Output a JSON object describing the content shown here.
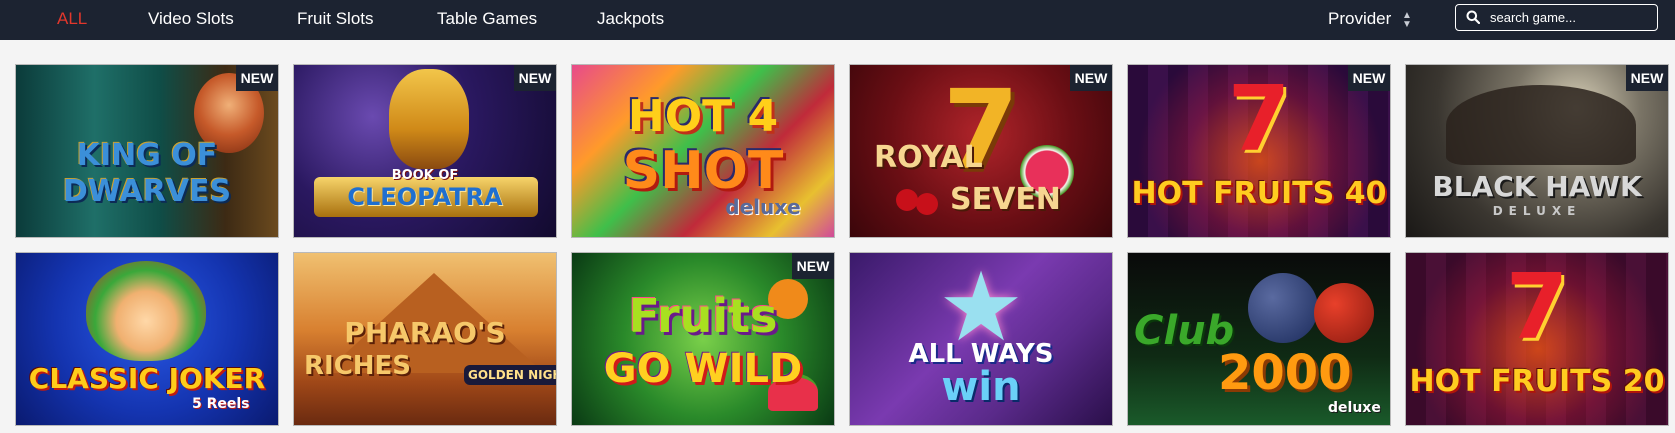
{
  "nav": {
    "items": [
      {
        "label": "ALL",
        "active": true
      },
      {
        "label": "Video Slots"
      },
      {
        "label": "Fruit Slots"
      },
      {
        "label": "Table Games"
      },
      {
        "label": "Jackpots"
      }
    ],
    "provider_label": "Provider",
    "search_placeholder": "search game..."
  },
  "colors": {
    "topbar": "#1c2331",
    "active_nav": "#e2372c",
    "page_bg": "#f4f4f4",
    "badge_bg": "#1c2331"
  },
  "badge_text": "NEW",
  "games": [
    {
      "title": "King of Dwarves",
      "art_lines": [
        "KING OF",
        "DWARVES"
      ],
      "is_new": true
    },
    {
      "title": "Book of Cleopatra",
      "art_lines": [
        "BOOK OF",
        "CLEOPATRA"
      ],
      "is_new": true
    },
    {
      "title": "Hot 4 Shot deluxe",
      "art_lines": [
        "HOT 4",
        "SHOT",
        "deluxe"
      ],
      "is_new": false
    },
    {
      "title": "Royal Seven",
      "art_lines": [
        "ROYAL",
        "SEVEN"
      ],
      "is_new": true
    },
    {
      "title": "Hot Fruits 40",
      "art_lines": [
        "HOT FRUITS 40"
      ],
      "is_new": true
    },
    {
      "title": "Black Hawk Deluxe",
      "art_lines": [
        "BLACK HAWK",
        "DELUXE"
      ],
      "is_new": true
    },
    {
      "title": "Classic Joker 5 Reels",
      "art_lines": [
        "CLASSIC JOKER",
        "5 Reels"
      ],
      "is_new": false
    },
    {
      "title": "Pharao's Riches Golden Nights Bonus",
      "art_lines": [
        "PHARAO'S",
        "RICHES",
        "GOLDEN NIGHTS"
      ],
      "is_new": false
    },
    {
      "title": "Fruits Go Wild",
      "art_lines": [
        "Fruits",
        "GO WILD"
      ],
      "is_new": true
    },
    {
      "title": "All Ways Win",
      "art_lines": [
        "ALL WAYS",
        "win"
      ],
      "is_new": false
    },
    {
      "title": "Club 2000 deluxe",
      "art_lines": [
        "Club",
        "2000",
        "deluxe"
      ],
      "is_new": false
    },
    {
      "title": "Hot Fruits 20",
      "art_lines": [
        "HOT FRUITS 20"
      ],
      "is_new": false
    }
  ]
}
